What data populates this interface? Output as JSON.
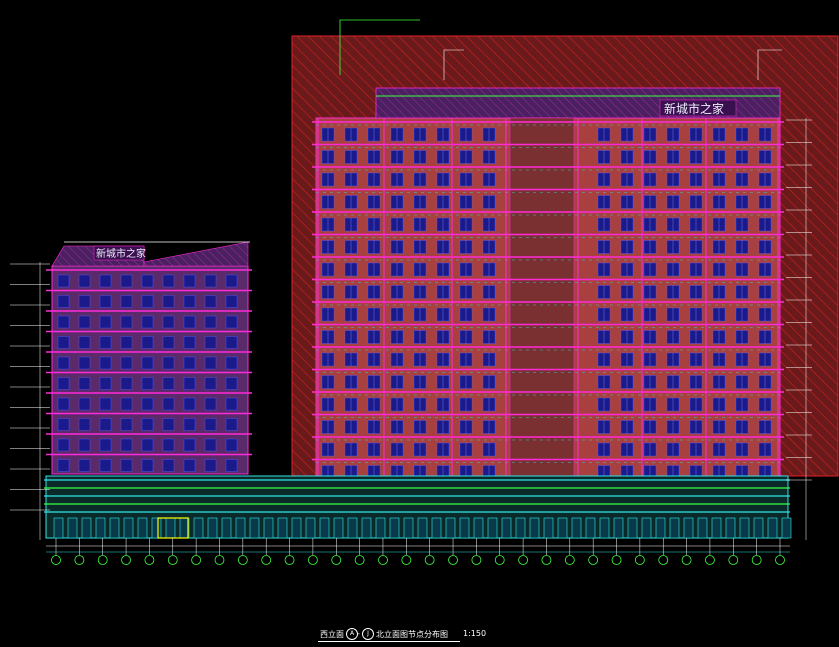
{
  "drawing": {
    "title_prefix": "西立面",
    "axis_start": "A",
    "axis_end": "J",
    "title_suffix": "北立面图节点分布图",
    "scale": "1:150",
    "left_sign": "新城市之家",
    "right_sign": "新城市之家",
    "axis_labels": [
      "32",
      "31",
      "30",
      "29",
      "28",
      "27",
      "26",
      "25",
      "24",
      "23",
      "22",
      "21",
      "20",
      "19",
      "18",
      "17",
      "16",
      "15",
      "14",
      "13",
      "12",
      "11",
      "10",
      "9",
      "8",
      "7",
      "6",
      "5",
      "4",
      "3",
      "2",
      "1"
    ]
  },
  "colors": {
    "background": "#000000",
    "facade_red": "#e0222a",
    "facade_fill": "#a84040",
    "magenta": "#ff2ad8",
    "cyan": "#2ee6e6",
    "green": "#3dff3d",
    "blue": "#3a3ad6",
    "yellow": "#ffff00",
    "white": "#ffffff"
  }
}
